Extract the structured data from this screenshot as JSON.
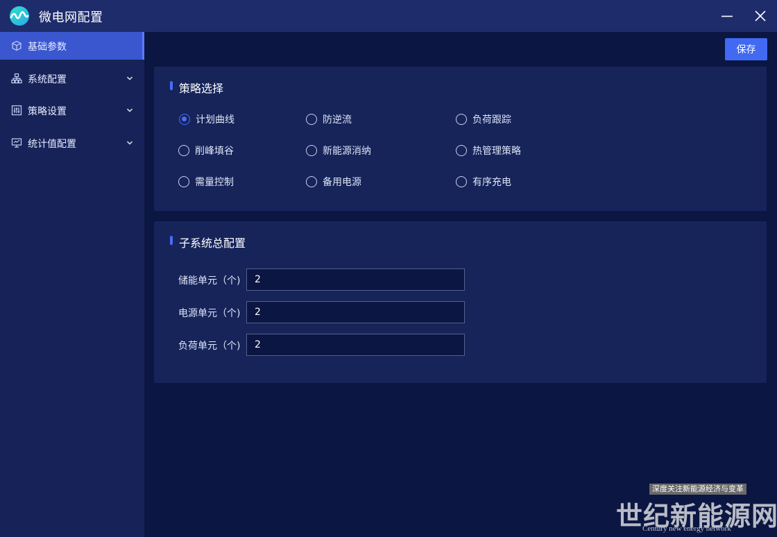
{
  "window": {
    "title": "微电网配置",
    "logo_icon": "wave-logo-icon",
    "minimize_icon": "minimize-icon",
    "close_icon": "close-icon"
  },
  "sidebar": {
    "items": [
      {
        "label": "基础参数",
        "icon": "cube-icon",
        "active": true
      },
      {
        "label": "系统配置",
        "icon": "network-icon",
        "expandable": true
      },
      {
        "label": "策略设置",
        "icon": "sliders-icon",
        "expandable": true
      },
      {
        "label": "统计值配置",
        "icon": "monitor-icon",
        "expandable": true
      }
    ]
  },
  "toolbar": {
    "save_label": "保存"
  },
  "strategy": {
    "title": "策略选择",
    "options": [
      {
        "label": "计划曲线",
        "checked": true
      },
      {
        "label": "防逆流",
        "checked": false
      },
      {
        "label": "负荷跟踪",
        "checked": false
      },
      {
        "label": "削峰填谷",
        "checked": false
      },
      {
        "label": "新能源消纳",
        "checked": false
      },
      {
        "label": "热管理策略",
        "checked": false
      },
      {
        "label": "需量控制",
        "checked": false
      },
      {
        "label": "备用电源",
        "checked": false
      },
      {
        "label": "有序充电",
        "checked": false
      }
    ]
  },
  "subsystem": {
    "title": "子系统总配置",
    "fields": [
      {
        "label": "储能单元（个)",
        "value": "2"
      },
      {
        "label": "电源单元（个)",
        "value": "2"
      },
      {
        "label": "负荷单元（个)",
        "value": "2"
      }
    ]
  },
  "watermark": {
    "tag": "深度关注新能源经济与变革",
    "main": "世纪新能源网",
    "sub": "Century new energy network"
  },
  "colors": {
    "titlebar": "#1e2c6b",
    "sidebar": "#172358",
    "main_bg": "#0b1642",
    "panel": "#16245a",
    "accent": "#4169f2"
  }
}
